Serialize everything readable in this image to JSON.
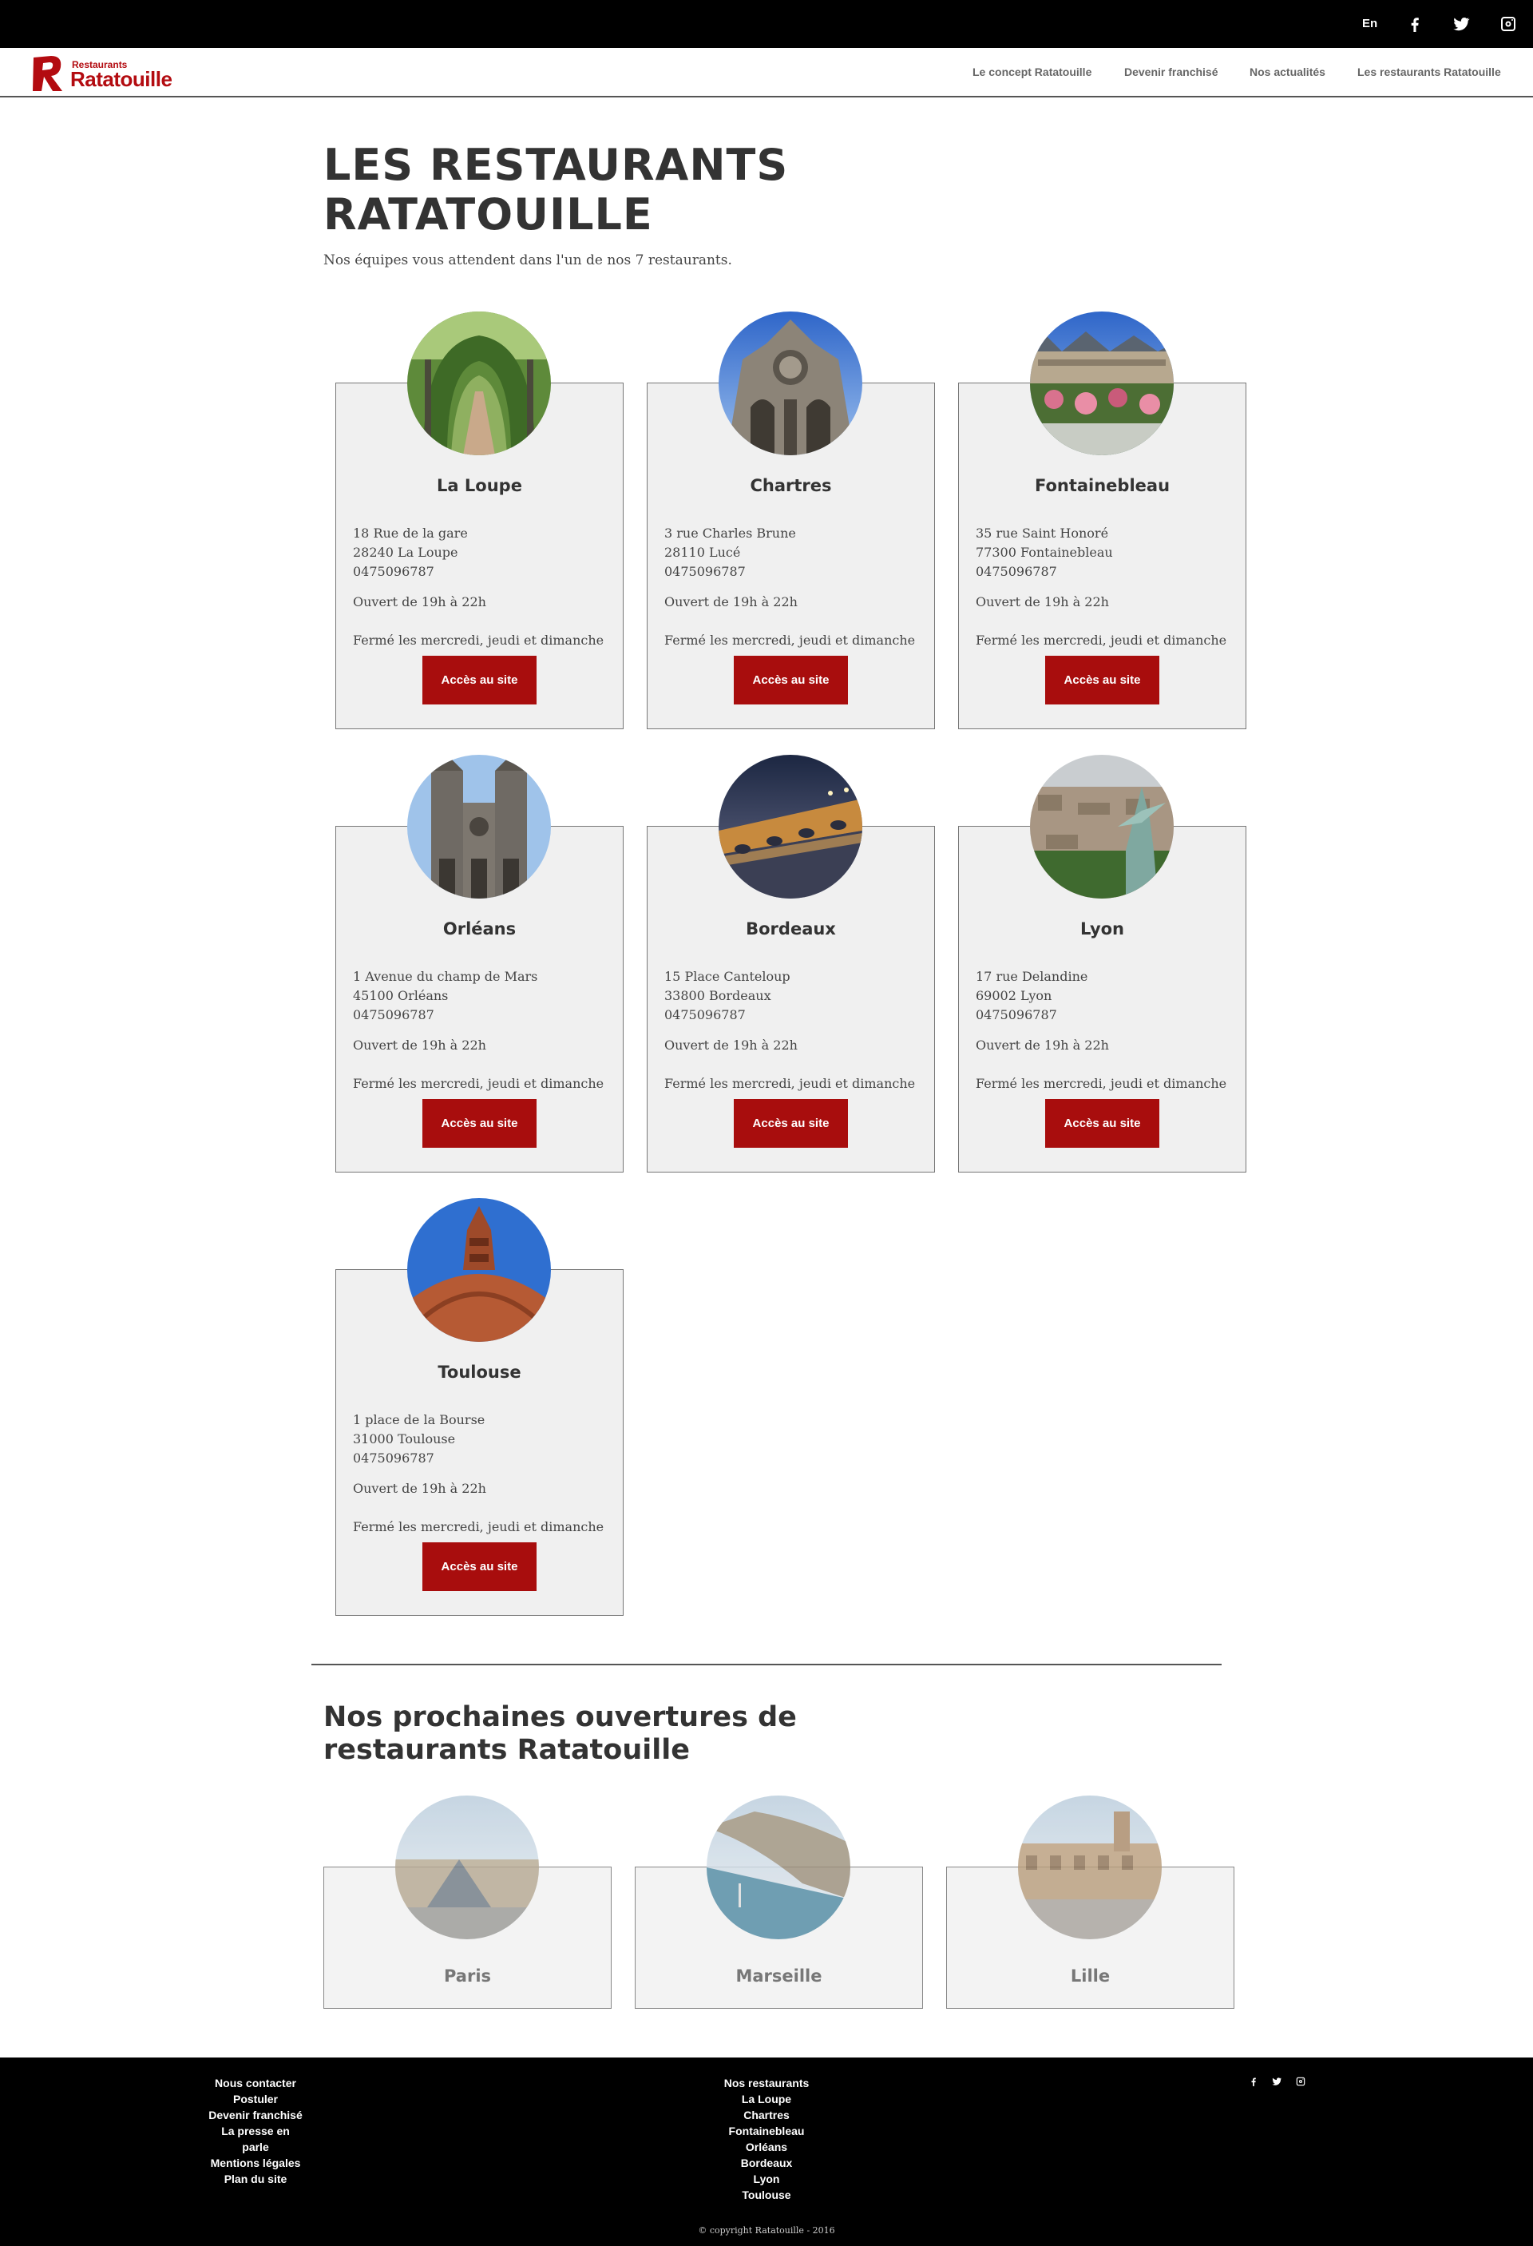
{
  "topbar": {
    "lang": "En",
    "icons": [
      "facebook-icon",
      "twitter-icon",
      "instagram-icon"
    ]
  },
  "logo": {
    "small": "Restaurants",
    "big": "Ratatouille"
  },
  "nav": [
    "Le concept Ratatouille",
    "Devenir franchisé",
    "Nos actualités",
    "Les restaurants Ratatouille"
  ],
  "page": {
    "title": "LES RESTAURANTS RATATOUILLE",
    "intro": "Nos équipes vous attendent dans l'un de nos 7 restaurants."
  },
  "restaurants": [
    {
      "name": "La Loupe",
      "street": "18 Rue de la gare",
      "city": "28240 La Loupe",
      "phone": "0475096787",
      "hours": "Ouvert de 19h à 22h",
      "closed": "Fermé les mercredi, jeudi et dimanche",
      "button": "Accès au site",
      "photo": "garden-arch-photo"
    },
    {
      "name": "Chartres",
      "street": "3 rue Charles Brune",
      "city": "28110 Lucé",
      "phone": "0475096787",
      "hours": "Ouvert de 19h à 22h",
      "closed": "Fermé les mercredi, jeudi et dimanche",
      "button": "Accès au site",
      "photo": "cathedral-photo"
    },
    {
      "name": "Fontainebleau",
      "street": "35 rue Saint Honoré",
      "city": "77300 Fontainebleau",
      "phone": "0475096787",
      "hours": "Ouvert de 19h à 22h",
      "closed": "Fermé les mercredi, jeudi et dimanche",
      "button": "Accès au site",
      "photo": "chateau-flowers-photo"
    },
    {
      "name": "Orléans",
      "street": "1 Avenue du champ de Mars",
      "city": "45100 Orléans",
      "phone": "0475096787",
      "hours": "Ouvert de 19h à 22h",
      "closed": "Fermé les mercredi, jeudi et dimanche",
      "button": "Accès au site",
      "photo": "orleans-cathedral-photo"
    },
    {
      "name": "Bordeaux",
      "street": "15 Place Canteloup",
      "city": "33800 Bordeaux",
      "phone": "0475096787",
      "hours": "Ouvert de 19h à 22h",
      "closed": "Fermé les mercredi, jeudi et dimanche",
      "button": "Accès au site",
      "photo": "bridge-night-photo"
    },
    {
      "name": "Lyon",
      "street": "17 rue Delandine",
      "city": "69002 Lyon",
      "phone": "0475096787",
      "hours": "Ouvert de 19h à 22h",
      "closed": "Fermé les mercredi, jeudi et dimanche",
      "button": "Accès au site",
      "photo": "city-statue-photo"
    },
    {
      "name": "Toulouse",
      "street": "1 place de la Bourse",
      "city": "31000 Toulouse",
      "phone": "0475096787",
      "hours": "Ouvert de 19h à 22h",
      "closed": "Fermé les mercredi, jeudi et dimanche",
      "button": "Accès au site",
      "photo": "brick-basilica-photo"
    }
  ],
  "upcoming": {
    "title": "Nos prochaines ouvertures de restaurants Ratatouille",
    "cities": [
      {
        "name": "Paris",
        "photo": "louvre-photo"
      },
      {
        "name": "Marseille",
        "photo": "calanque-photo"
      },
      {
        "name": "Lille",
        "photo": "grand-place-photo"
      }
    ]
  },
  "footer": {
    "col1": [
      "Nous contacter",
      "Postuler",
      "Devenir franchisé",
      "La presse en parle",
      "Mentions légales",
      "Plan du site"
    ],
    "col2": [
      "Nos restaurants",
      "La Loupe",
      "Chartres",
      "Fontainebleau",
      "Orléans",
      "Bordeaux",
      "Lyon",
      "Toulouse"
    ],
    "copyright": "© copyright Ratatouille - 2016"
  },
  "colors": {
    "brand_red": "#a80d0d",
    "topbar": "#000000",
    "card_bg": "#f0f0f0"
  }
}
